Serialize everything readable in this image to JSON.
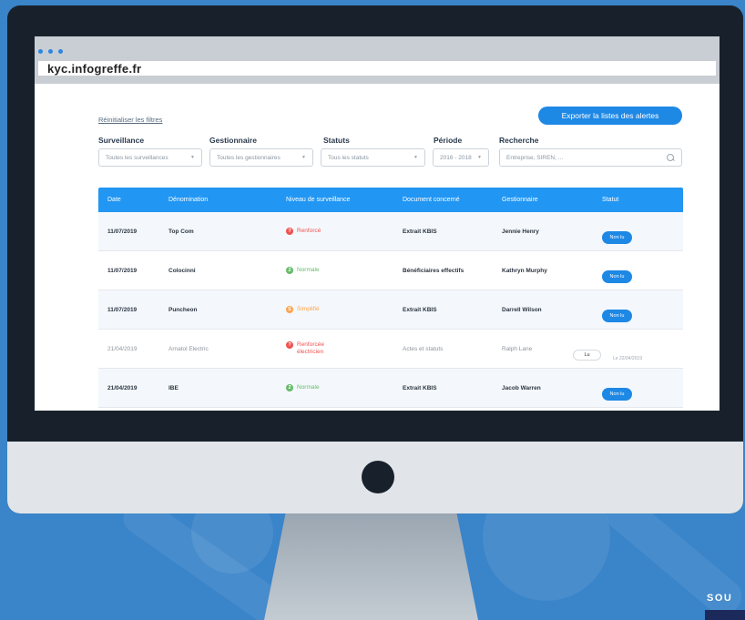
{
  "browser": {
    "url": "kyc.infogreffe.fr"
  },
  "toolbar": {
    "reset_filters": "Réinitialiser les filtres",
    "export_label": "Exporter la listes des alertes"
  },
  "filters": {
    "surveillance": {
      "label": "Surveillance",
      "value": "Toutes les surveillances"
    },
    "gestionnaire": {
      "label": "Gestionnaire",
      "value": "Toutes les gestionnaires"
    },
    "statuts": {
      "label": "Statuts",
      "value": "Tous les statuts"
    },
    "periode": {
      "label": "Période",
      "value": "2016 - 2018"
    },
    "recherche": {
      "label": "Recherche",
      "placeholder": "Entreprise, SIREN, ..."
    }
  },
  "table": {
    "headers": [
      "Date",
      "Dénomination",
      "Niveau de surveillance",
      "Document concerné",
      "Gestionnaire",
      "Statut"
    ],
    "rows": [
      {
        "date": "11/07/2019",
        "denomination": "Top Com",
        "niveau": "Renforcé",
        "niveau_icon": "?",
        "document": "Extrait KBIS",
        "gestionnaire": "Jennie Henry",
        "statut": "Non lu"
      },
      {
        "date": "11/07/2019",
        "denomination": "Colocinni",
        "niveau": "Normale",
        "niveau_icon": "2",
        "document": "Bénéficiaires effectifs",
        "gestionnaire": "Kathryn Murphy",
        "statut": "Non lu"
      },
      {
        "date": "11/07/2019",
        "denomination": "Puncheon",
        "niveau": "Simplifié",
        "niveau_icon": "S",
        "document": "Extrait KBIS",
        "gestionnaire": "Darrell Wilson",
        "statut": "Non lu"
      },
      {
        "date": "21/04/2019",
        "denomination": "Arnatol Electric",
        "niveau": "Renforcée électricien",
        "niveau_icon": "?",
        "document": "Actes et statuts",
        "gestionnaire": "Ralph Lane",
        "statut": "Lu",
        "read_date": "Le 22/04/2019"
      },
      {
        "date": "21/04/2019",
        "denomination": "IBE",
        "niveau": "Normale",
        "niveau_icon": "2",
        "document": "Extrait KBIS",
        "gestionnaire": "Jacob Warren",
        "statut": "Non lu"
      }
    ]
  },
  "colors": {
    "background": "#3a84c9",
    "accent": "#1e88e5",
    "header": "#2196f3",
    "renforce": "#ef5350",
    "normale": "#66bb6a",
    "simplifie": "#ffa24c"
  },
  "brand_text": "SOU"
}
